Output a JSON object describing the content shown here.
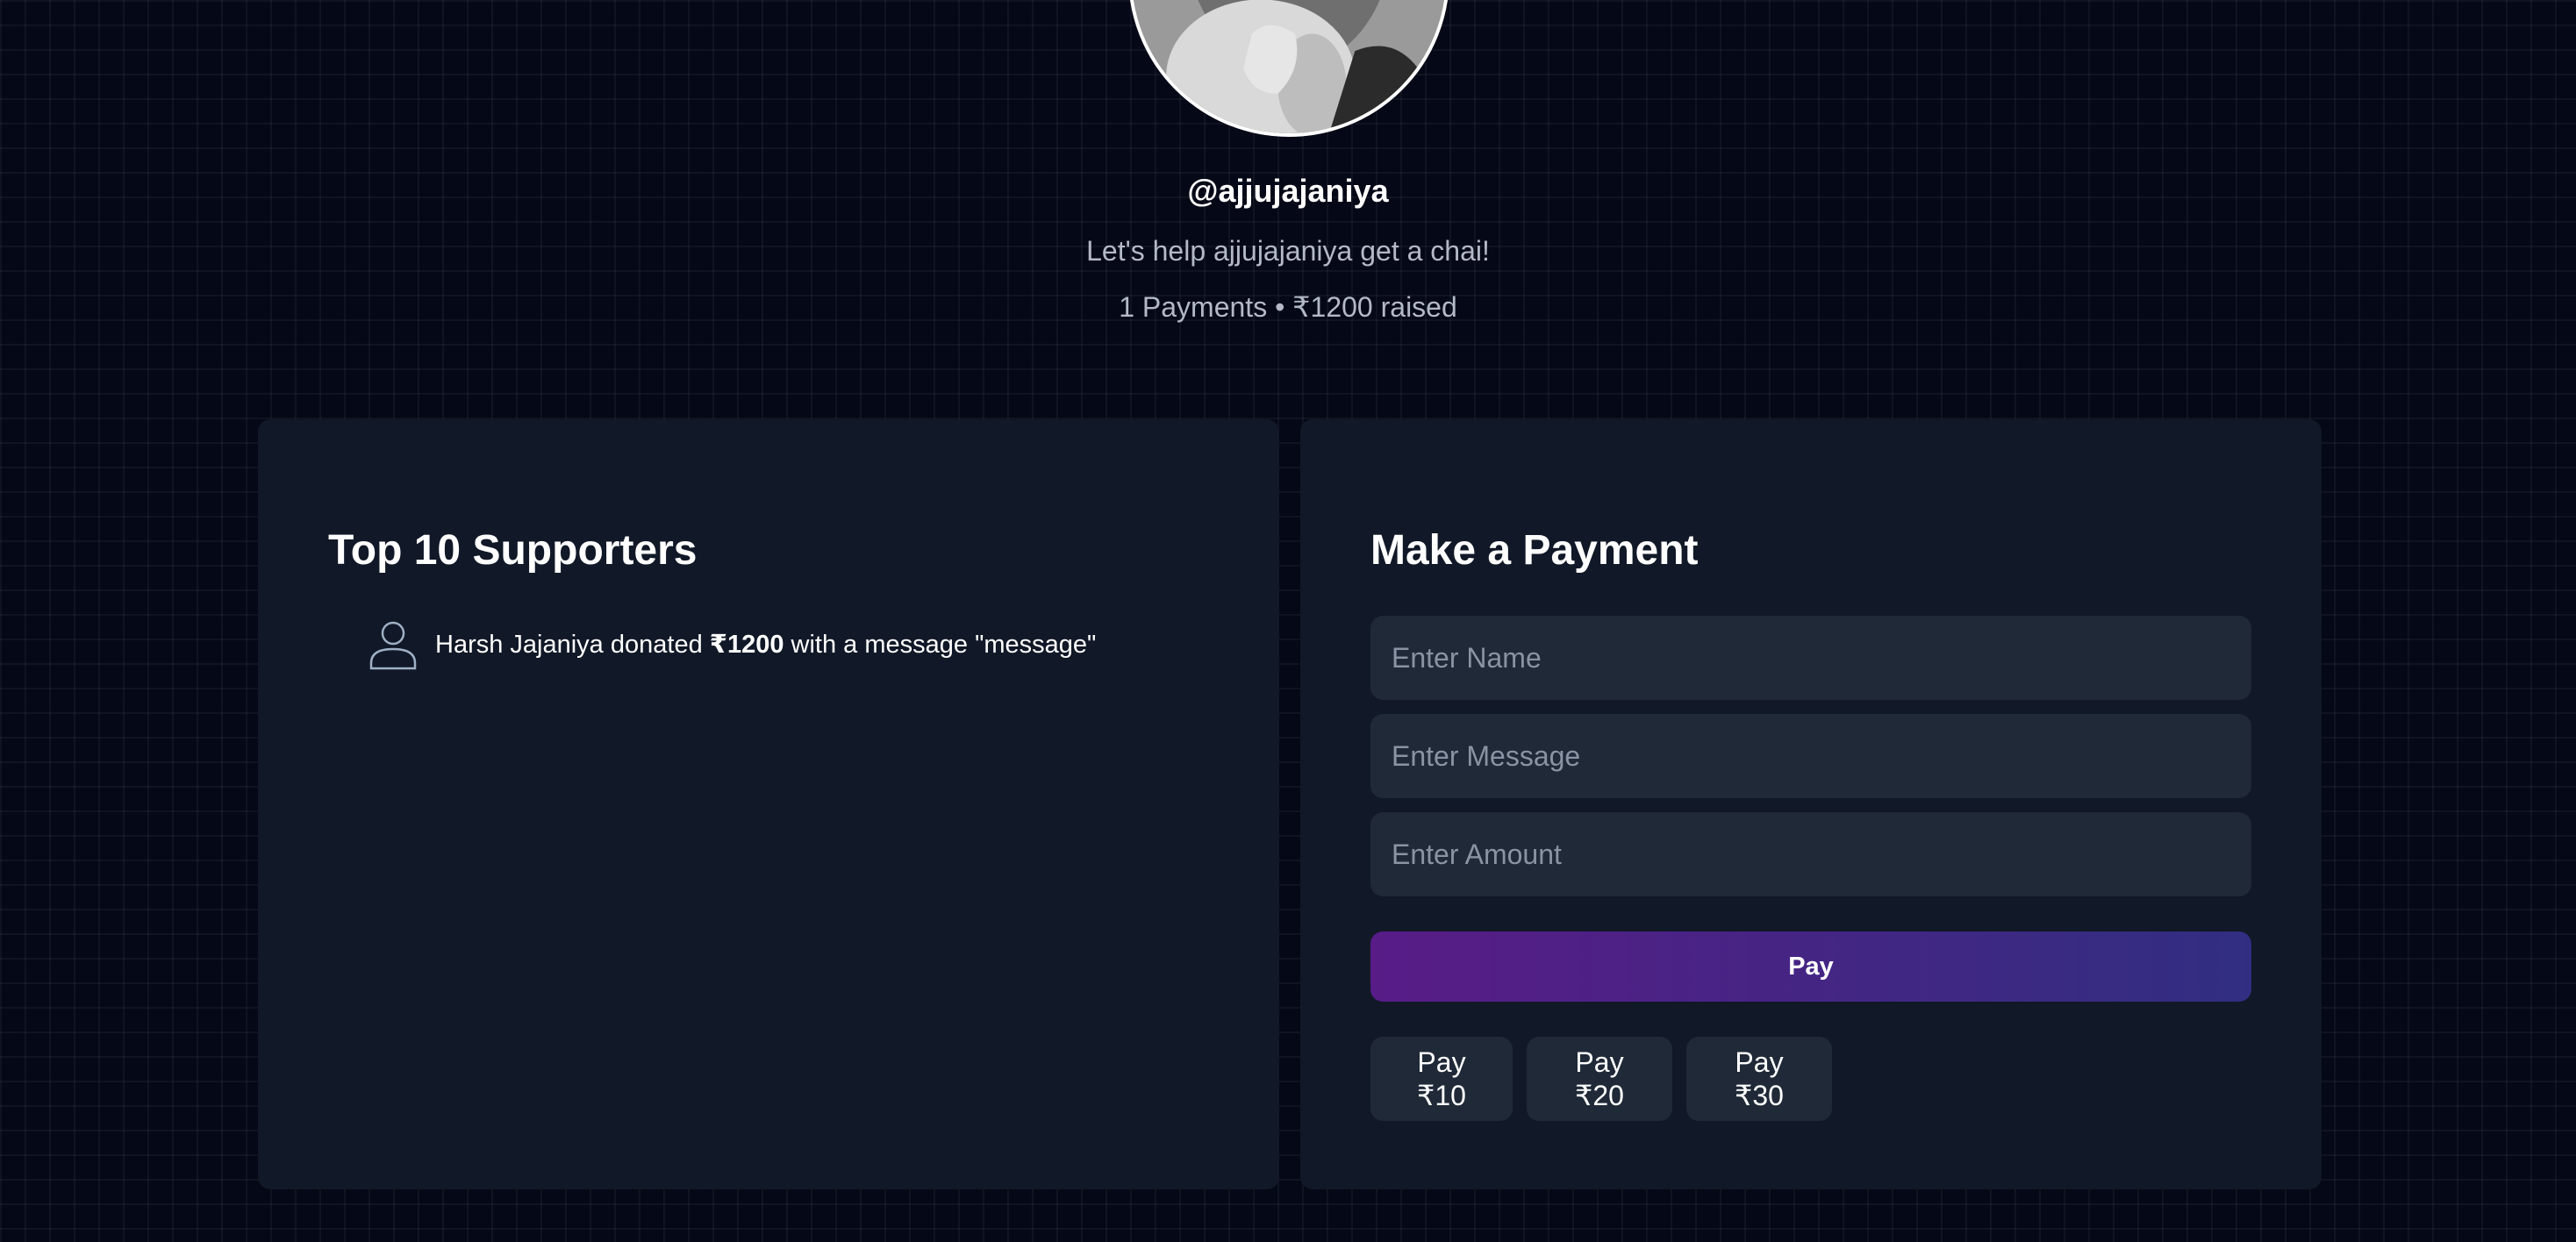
{
  "profile": {
    "username": "@ajjujajaniya",
    "tagline": "Let's help ajjujajaniya get a chai!",
    "stats": "1 Payments • ₹1200 raised"
  },
  "supporters": {
    "title": "Top 10 Supporters",
    "items": [
      {
        "name": "Harsh Jajaniya",
        "donated_text": " donated ",
        "amount": "₹1200",
        "message_text": " with a message \"message\""
      }
    ]
  },
  "payment": {
    "title": "Make a Payment",
    "name_placeholder": "Enter Name",
    "message_placeholder": "Enter Message",
    "amount_placeholder": "Enter Amount",
    "pay_label": "Pay",
    "quick_amounts": [
      "Pay ₹10",
      "Pay ₹20",
      "Pay ₹30"
    ]
  },
  "colors": {
    "background": "#050816",
    "panel": "#111827",
    "input": "#1f2937",
    "pay_gradient_start": "#581c87",
    "pay_gradient_end": "#312e81"
  }
}
